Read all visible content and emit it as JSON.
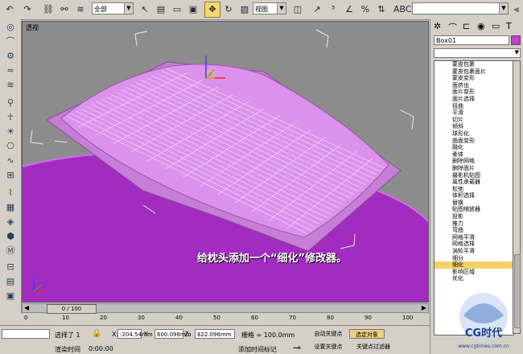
{
  "toolbar": {
    "selection_filter": "全部",
    "reference_coord": "视图",
    "named_selection": ""
  },
  "viewport": {
    "label": "透视",
    "caption": "给枕头添加一个“细化”修改器。"
  },
  "command_panel": {
    "object_name": "Box01",
    "object_color": "#c040d0",
    "modifiers": [
      "蒙皮包裹",
      "蒙皮包裹面片",
      "蒙皮变形",
      "面挤出",
      "面片变形",
      "面片选择",
      "扭曲",
      "平滑",
      "切片",
      "倾斜",
      "球形化",
      "曲面变形",
      "融化",
      "柔体",
      "删除网格",
      "删除面片",
      "摄影机贴图",
      "属性承载器",
      "松弛",
      "体积选择",
      "替换",
      "贴图缩放器",
      "投影",
      "推力",
      "弯曲",
      "网格平滑",
      "网格选择",
      "涡轮平滑",
      "细分",
      "细化",
      "影响区域",
      "优化"
    ],
    "selected_modifier": "细化"
  },
  "timeline": {
    "frame_display": "0 / 100",
    "ticks": [
      "0",
      "10",
      "20",
      "30",
      "40",
      "50",
      "60",
      "70",
      "80",
      "90",
      "100"
    ]
  },
  "status": {
    "selected_text": "选择了 1",
    "x_label": "X:",
    "x_value": "-204.54mm",
    "y_label": "Y:",
    "y_value": "600.098mm",
    "z_label": "Z:",
    "z_value": "822.096mm",
    "grid_label": "栅格 = 100.0mm",
    "auto_key": "自动关键点",
    "selected_set": "选定对象",
    "set_key": "设置关键点",
    "key_filters": "关键点过滤器",
    "render_time_label": "渲染时间",
    "render_time_value": "0:00:00",
    "add_time_tag": "添加时间标记"
  },
  "watermark": {
    "text": "CG时代",
    "url": "www.cgtimes.com.cn"
  },
  "colors": {
    "pillow": "#d98ce8",
    "ground": "#a030c0",
    "selection": "#f4d26a"
  }
}
